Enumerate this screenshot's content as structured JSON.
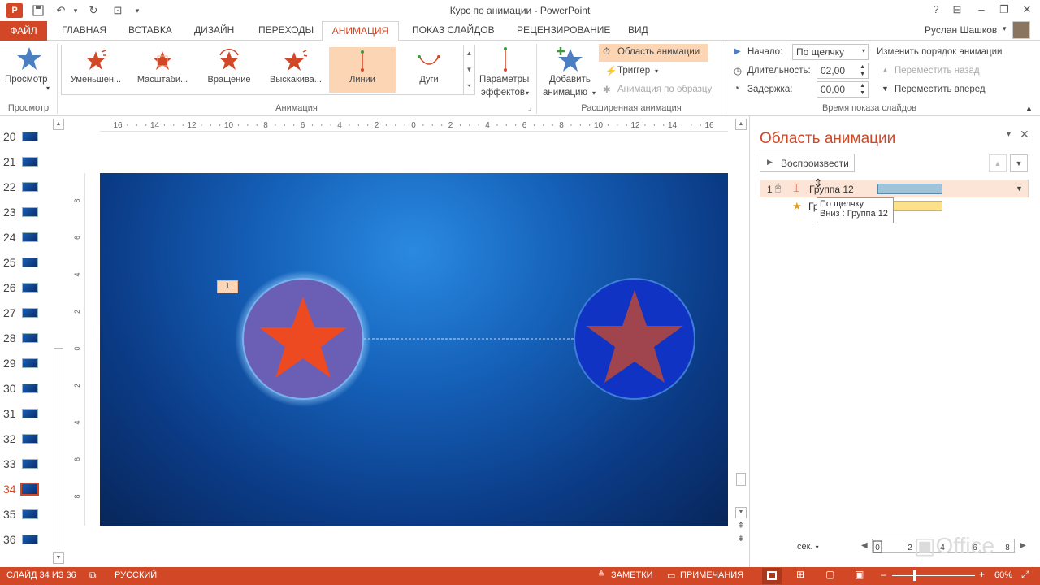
{
  "window": {
    "title": "Курс по анимации - PowerPoint",
    "help": "?",
    "user": "Руслан Шашков"
  },
  "tabs": {
    "file": "ФАЙЛ",
    "home": "ГЛАВНАЯ",
    "insert": "ВСТАВКА",
    "design": "ДИЗАЙН",
    "transitions": "ПЕРЕХОДЫ",
    "animation": "АНИМАЦИЯ",
    "slideshow": "ПОКАЗ СЛАЙДОВ",
    "review": "РЕЦЕНЗИРОВАНИЕ",
    "view": "ВИД"
  },
  "ribbon": {
    "preview_label": "Просмотр",
    "preview_group": "Просмотр",
    "gallery": [
      {
        "label": "Уменьшен...",
        "color": "#d24726"
      },
      {
        "label": "Масштаби...",
        "color": "#d24726"
      },
      {
        "label": "Вращение",
        "color": "#d24726"
      },
      {
        "label": "Выскакива...",
        "color": "#d24726"
      },
      {
        "label": "Линии",
        "color": "#d24726"
      },
      {
        "label": "Дуги",
        "color": "#d24726"
      }
    ],
    "animation_group": "Анимация",
    "effects_line1": "Параметры",
    "effects_line2": "эффектов",
    "add_line1": "Добавить",
    "add_line2": "анимацию",
    "anim_pane": "Область анимации",
    "trigger": "Триггер",
    "anim_painter": "Анимация по образцу",
    "advanced_group": "Расширенная анимация",
    "start_label": "Начало:",
    "start_value": "По щелчку",
    "duration_label": "Длительность:",
    "duration_value": "02,00",
    "delay_label": "Задержка:",
    "delay_value": "00,00",
    "reorder": "Изменить порядок анимации",
    "move_earlier": "Переместить назад",
    "move_later": "Переместить вперед",
    "timing_group": "Время показа слайдов"
  },
  "thumbnails": [
    "20",
    "21",
    "22",
    "23",
    "24",
    "25",
    "26",
    "27",
    "28",
    "29",
    "30",
    "31",
    "32",
    "33",
    "34",
    "35",
    "36"
  ],
  "active_thumbnail": "34",
  "ruler_numbers": [
    "16",
    "14",
    "12",
    "10",
    "8",
    "6",
    "4",
    "2",
    "0",
    "2",
    "4",
    "6",
    "8",
    "10",
    "12",
    "14",
    "16"
  ],
  "vruler_numbers": [
    "8",
    "6",
    "4",
    "2",
    "0",
    "2",
    "4",
    "6",
    "8"
  ],
  "slide": {
    "anim_tag": "1"
  },
  "anim_pane": {
    "title": "Область анимации",
    "play": "Воспроизвести",
    "item1_num": "1",
    "item1_name": "Группа 12",
    "item2_name": "Гру",
    "tooltip_line1": "По щелчку",
    "tooltip_line2": "Вниз : Группа 12",
    "seconds": "сек.",
    "timeline": [
      "0",
      "2",
      "4",
      "6",
      "8"
    ]
  },
  "status": {
    "slide": "СЛАЙД 34 ИЗ 36",
    "lang": "РУССКИЙ",
    "notes": "ЗАМЕТКИ",
    "comments": "ПРИМЕЧАНИЯ",
    "zoom": "60%"
  },
  "colors": {
    "accent": "#d24726",
    "selected_gallery": "#fcd5b4",
    "timeline_bar1": "#9fc3d8",
    "timeline_bar2": "#fde18a"
  }
}
